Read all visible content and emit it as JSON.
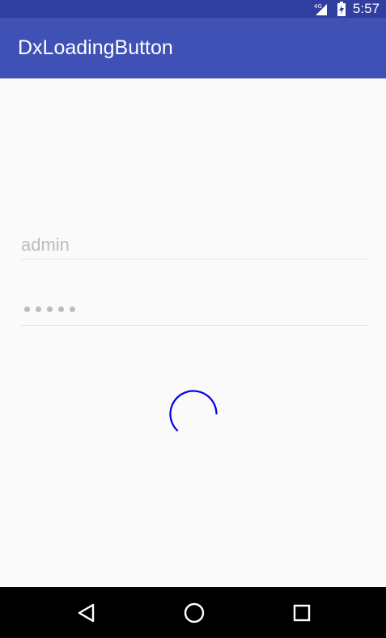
{
  "status_bar": {
    "time": "5:57",
    "network_label": "4G",
    "icons": [
      "signal-icon",
      "battery-charging-icon"
    ]
  },
  "app_bar": {
    "title": "DxLoadingButton",
    "background": "#3f51b5",
    "status_background": "#303f9f"
  },
  "form": {
    "username": {
      "value": "admin"
    },
    "password": {
      "masked_length": 5
    }
  },
  "loading_button": {
    "state": "loading",
    "spinner_color": "#0000ee"
  },
  "nav_bar": {
    "buttons": [
      "back-icon",
      "home-icon",
      "recents-icon"
    ]
  }
}
